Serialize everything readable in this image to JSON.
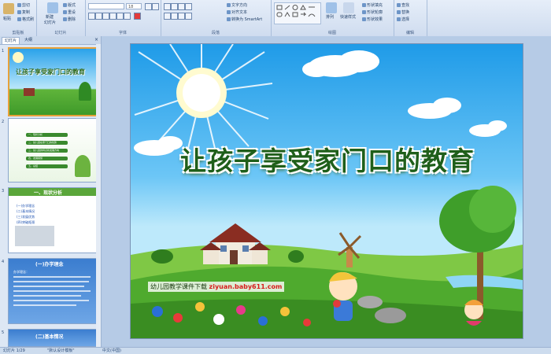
{
  "ribbon": {
    "clipboard": {
      "paste": "粘贴",
      "cut": "剪切",
      "copy": "复制",
      "format_painter": "格式刷",
      "label": "剪贴板"
    },
    "slides": {
      "new_slide": "新建",
      "new_slide2": "幻灯片",
      "layout": "版式",
      "reset": "重设",
      "delete": "删除",
      "label": "幻灯片"
    },
    "font": {
      "font_name": "",
      "font_size": "18",
      "label": "字体"
    },
    "paragraph": {
      "text_direction": "文字方向",
      "align_text": "对齐文本",
      "smartart": "转换为 SmartArt",
      "label": "段落"
    },
    "drawing": {
      "arrange": "排列",
      "quick_styles": "快速样式",
      "shape_fill": "形状填充",
      "shape_outline": "形状轮廓",
      "shape_effects": "形状效果",
      "label": "绘图"
    },
    "editing": {
      "find": "查找",
      "replace": "替换",
      "select": "选择",
      "label": "编辑"
    }
  },
  "panel": {
    "tab_slides": "幻灯片",
    "tab_outline": "大纲",
    "close": "×"
  },
  "thumbs": {
    "t1": {
      "num": "1",
      "title": "让孩子享受家门口的教育"
    },
    "t2": {
      "num": "2",
      "items": [
        "一、现状分析",
        "二、幼儿园在家门口的优势",
        "三、幼儿园的特点和发展方向",
        "四、发展措施",
        "五、总结"
      ]
    },
    "t3": {
      "num": "3",
      "title": "一、现状分析",
      "items": [
        "(一)办学理念",
        "(二)基本情况",
        "(三)发展优势",
        "(四)突破瓶颈"
      ]
    },
    "t4": {
      "num": "4",
      "title": "(一)办学理念",
      "items": [
        "办学理念：",
        "•"
      ]
    },
    "t5": {
      "num": "5",
      "title": "(二)基本情况"
    }
  },
  "slide": {
    "title": "让孩子享受家门口的教育",
    "site_label": "幼儿园教学课件下载",
    "site_url": "ziyuan.baby611.com"
  },
  "status": {
    "slide_count": "幻灯片 1/29",
    "theme": "\"默认设计模板\"",
    "language": "中文(中国)"
  },
  "colors": {
    "title_green": "#1f5f1a",
    "selected_border": "#e8a13a",
    "url_red": "#d81b1b"
  }
}
